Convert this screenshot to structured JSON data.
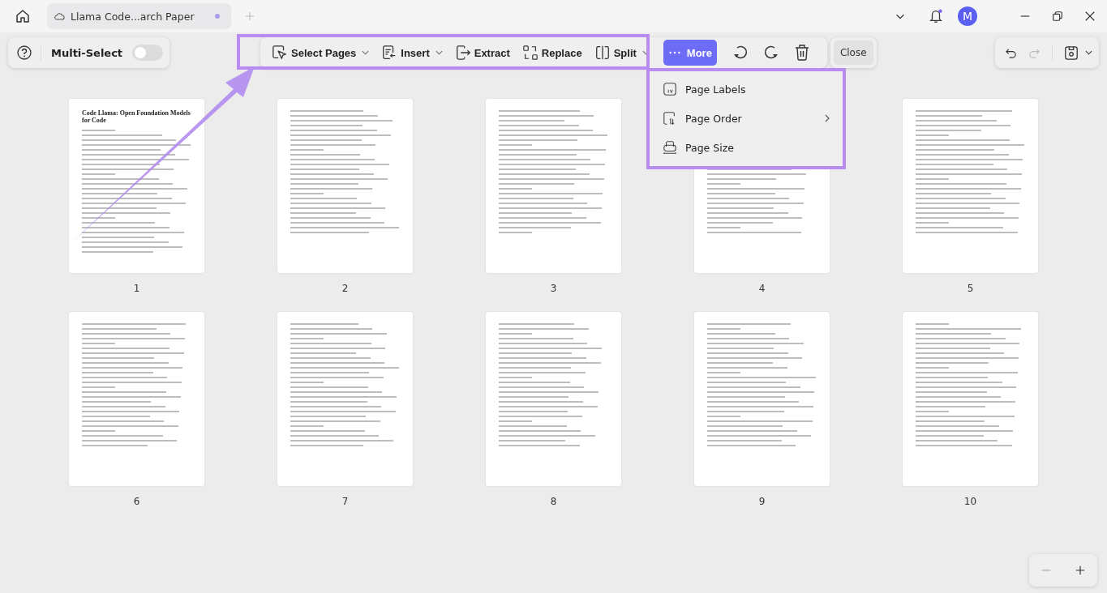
{
  "tab": {
    "title": "Llama Code...arch Paper",
    "unsaved": true
  },
  "user": {
    "initial": "M"
  },
  "notifications": {
    "unread": true
  },
  "multi_select": {
    "label": "Multi-Select",
    "on": false
  },
  "tools": [
    {
      "label": "Select Pages",
      "has_menu": true,
      "selected": false
    },
    {
      "label": "Insert",
      "has_menu": true,
      "selected": false
    },
    {
      "label": "Extract",
      "has_menu": false,
      "selected": false
    },
    {
      "label": "Replace",
      "has_menu": false,
      "selected": false
    },
    {
      "label": "Split",
      "has_menu": true,
      "selected": false
    },
    {
      "label": "More",
      "has_menu": false,
      "selected": true
    }
  ],
  "close_button": "Close",
  "more_menu": [
    {
      "label": "Page Labels",
      "submenu": false
    },
    {
      "label": "Page Order",
      "submenu": true
    },
    {
      "label": "Page Size",
      "submenu": false
    }
  ],
  "pages": [
    {
      "number": "1",
      "title": "Code Llama: Open Foundation Models for Code"
    },
    {
      "number": "2"
    },
    {
      "number": "3"
    },
    {
      "number": "4"
    },
    {
      "number": "5"
    },
    {
      "number": "6"
    },
    {
      "number": "7"
    },
    {
      "number": "8"
    },
    {
      "number": "9"
    },
    {
      "number": "10"
    }
  ]
}
